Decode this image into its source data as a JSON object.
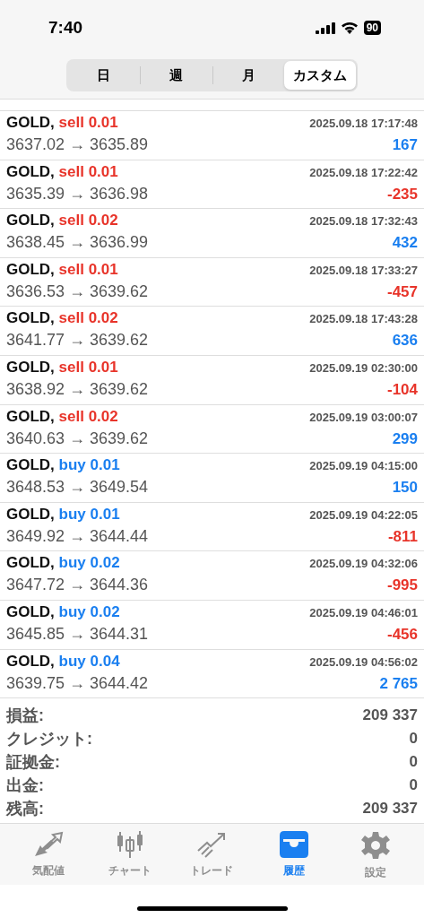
{
  "status_bar": {
    "time": "7:40",
    "battery": "90"
  },
  "period_tabs": [
    {
      "label": "日",
      "selected": false
    },
    {
      "label": "週",
      "selected": false
    },
    {
      "label": "月",
      "selected": false
    },
    {
      "label": "カスタム",
      "selected": true
    }
  ],
  "deals": [
    {
      "symbol": "GOLD,",
      "side": "sell",
      "lots": "0.01",
      "time": "2025.09.18 17:17:48",
      "prices": "3637.02 → 3635.89",
      "profit": "167",
      "loss": false
    },
    {
      "symbol": "GOLD,",
      "side": "sell",
      "lots": "0.01",
      "time": "2025.09.18 17:22:42",
      "prices": "3635.39 → 3636.98",
      "profit": "-235",
      "loss": true
    },
    {
      "symbol": "GOLD,",
      "side": "sell",
      "lots": "0.02",
      "time": "2025.09.18 17:32:43",
      "prices": "3638.45 → 3636.99",
      "profit": "432",
      "loss": false
    },
    {
      "symbol": "GOLD,",
      "side": "sell",
      "lots": "0.01",
      "time": "2025.09.18 17:33:27",
      "prices": "3636.53 → 3639.62",
      "profit": "-457",
      "loss": true
    },
    {
      "symbol": "GOLD,",
      "side": "sell",
      "lots": "0.02",
      "time": "2025.09.18 17:43:28",
      "prices": "3641.77 → 3639.62",
      "profit": "636",
      "loss": false
    },
    {
      "symbol": "GOLD,",
      "side": "sell",
      "lots": "0.01",
      "time": "2025.09.19 02:30:00",
      "prices": "3638.92 → 3639.62",
      "profit": "-104",
      "loss": true
    },
    {
      "symbol": "GOLD,",
      "side": "sell",
      "lots": "0.02",
      "time": "2025.09.19 03:00:07",
      "prices": "3640.63 → 3639.62",
      "profit": "299",
      "loss": false
    },
    {
      "symbol": "GOLD,",
      "side": "buy",
      "lots": "0.01",
      "time": "2025.09.19 04:15:00",
      "prices": "3648.53 → 3649.54",
      "profit": "150",
      "loss": false
    },
    {
      "symbol": "GOLD,",
      "side": "buy",
      "lots": "0.01",
      "time": "2025.09.19 04:22:05",
      "prices": "3649.92 → 3644.44",
      "profit": "-811",
      "loss": true
    },
    {
      "symbol": "GOLD,",
      "side": "buy",
      "lots": "0.02",
      "time": "2025.09.19 04:32:06",
      "prices": "3647.72 → 3644.36",
      "profit": "-995",
      "loss": true
    },
    {
      "symbol": "GOLD,",
      "side": "buy",
      "lots": "0.02",
      "time": "2025.09.19 04:46:01",
      "prices": "3645.85 → 3644.31",
      "profit": "-456",
      "loss": true
    },
    {
      "symbol": "GOLD,",
      "side": "buy",
      "lots": "0.04",
      "time": "2025.09.19 04:56:02",
      "prices": "3639.75 → 3644.42",
      "profit": "2 765",
      "loss": false
    }
  ],
  "summary": [
    {
      "label": "損益:",
      "value": "209 337"
    },
    {
      "label": "クレジット:",
      "value": "0"
    },
    {
      "label": "証拠金:",
      "value": "0"
    },
    {
      "label": "出金:",
      "value": "0"
    },
    {
      "label": "残高:",
      "value": "209 337"
    }
  ],
  "tab_bar": [
    {
      "kind": "quotes",
      "label": "気配値",
      "selected": false
    },
    {
      "kind": "chart",
      "label": "チャート",
      "selected": false
    },
    {
      "kind": "trade",
      "label": "トレード",
      "selected": false
    },
    {
      "kind": "history",
      "label": "履歴",
      "selected": true
    },
    {
      "kind": "settings",
      "label": "設定",
      "selected": false
    }
  ]
}
